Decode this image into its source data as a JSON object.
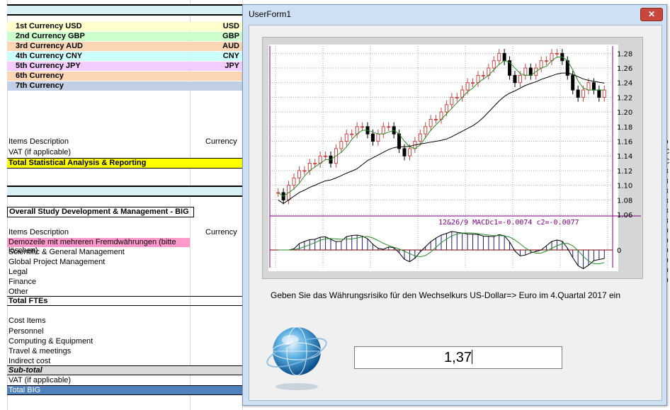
{
  "sheet": {
    "currencies": [
      {
        "label": "1st Currency USD",
        "code": "USD",
        "color": "#ffffcc"
      },
      {
        "label": "2nd Currency GBP",
        "code": "GBP",
        "color": "#ccffcc"
      },
      {
        "label": "3rd Currency AUD",
        "code": "AUD",
        "color": "#fcd5b4"
      },
      {
        "label": "4th Currency CNY",
        "code": "CNY",
        "color": "#ccffff"
      },
      {
        "label": "5th Currency JPY",
        "code": "JPY",
        "color": "#f2ccff"
      },
      {
        "label": "6th Currency",
        "code": "",
        "color": "#fcd5b4"
      },
      {
        "label": "7th Currency",
        "code": "",
        "color": "#c0cfe4"
      }
    ],
    "items_description_1": "Items Description",
    "currency_header_1": "Currency",
    "vat_1": "VAT (if applicable)",
    "total_statistical": "Total Statistical Analysis & Reporting",
    "overall_title": "Overall Study Development & Management - BIG",
    "items_description_2": "Items Description",
    "currency_header_2": "Currency",
    "demo_row": "Demozeile mit mehreren Fremdwährungen (bitte löschen)",
    "fte_rows": [
      "Scientific & General Management",
      "Global Project Management",
      "Legal",
      "Finance",
      "Other"
    ],
    "total_ftes": "Total FTEs",
    "cost_items": "Cost Items",
    "cost_rows": [
      "Personnel",
      "Computing & Equipment",
      "Travel & meetings",
      "Indirect cost"
    ],
    "subtotal": "Sub-total",
    "vat_2": "VAT (if applicable)",
    "total_big": "Total BIG",
    "edge_bits": [
      "o",
      "C",
      "C",
      "8",
      "8",
      "8",
      "8",
      "8",
      "8",
      "0",
      "0",
      "0",
      "0",
      "0",
      "0"
    ]
  },
  "dialog": {
    "title": "UserForm1",
    "close_label": "✕",
    "prompt": "Geben Sie das Währungsrisiko für den Wechselkurs US-Dollar=> Euro im 4.Quartal 2017 ein",
    "input_value": "1,37"
  },
  "chart_data": {
    "type": "candlestick",
    "price_axis_ticks": [
      "1.28",
      "1.26",
      "1.24",
      "1.22",
      "1.20",
      "1.18",
      "1.16",
      "1.14",
      "1.12",
      "1.10",
      "1.08",
      "1.06"
    ],
    "ylim": [
      1.06,
      1.29
    ],
    "macd_label": "12&26/9  MACDc1=-0.0074  c2=-0.0077",
    "macd_zero_label": "0",
    "close_series": [
      1.09,
      1.08,
      1.1,
      1.11,
      1.12,
      1.12,
      1.13,
      1.13,
      1.14,
      1.14,
      1.13,
      1.15,
      1.16,
      1.17,
      1.17,
      1.18,
      1.18,
      1.17,
      1.16,
      1.17,
      1.18,
      1.18,
      1.17,
      1.15,
      1.14,
      1.15,
      1.16,
      1.17,
      1.18,
      1.19,
      1.19,
      1.2,
      1.21,
      1.22,
      1.22,
      1.23,
      1.24,
      1.24,
      1.25,
      1.25,
      1.26,
      1.27,
      1.28,
      1.27,
      1.25,
      1.24,
      1.25,
      1.26,
      1.25,
      1.26,
      1.27,
      1.27,
      1.28,
      1.28,
      1.27,
      1.25,
      1.23,
      1.22,
      1.23,
      1.24,
      1.23,
      1.22,
      1.23
    ],
    "colors": {
      "up": "#cc4444",
      "down": "#000000",
      "ma_fast": "#2a8a2a",
      "ma_slow": "#000000",
      "axis": "#800080",
      "macd_label": "#800080"
    }
  }
}
